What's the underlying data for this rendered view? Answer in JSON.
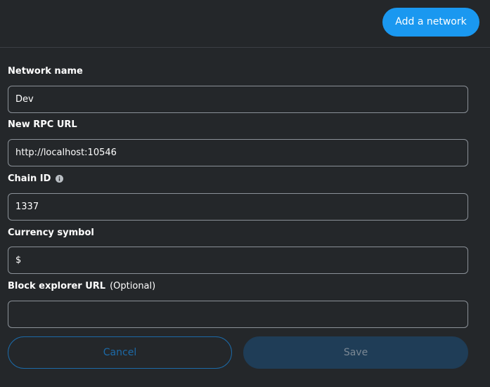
{
  "header": {
    "add_network_label": "Add a network"
  },
  "form": {
    "network_name": {
      "label": "Network name",
      "value": "Dev"
    },
    "rpc_url": {
      "label": "New RPC URL",
      "value": "http://localhost:10546"
    },
    "chain_id": {
      "label": "Chain ID",
      "value": "1337"
    },
    "currency_symbol": {
      "label": "Currency symbol",
      "value": "$"
    },
    "block_explorer": {
      "label": "Block explorer URL",
      "optional_label": "(Optional)",
      "value": ""
    }
  },
  "actions": {
    "cancel_label": "Cancel",
    "save_label": "Save"
  },
  "colors": {
    "background": "#24272a",
    "accent": "#1a98f0",
    "input_border": "#8b9198"
  },
  "icons": {
    "chain_id_info": "info-icon"
  }
}
